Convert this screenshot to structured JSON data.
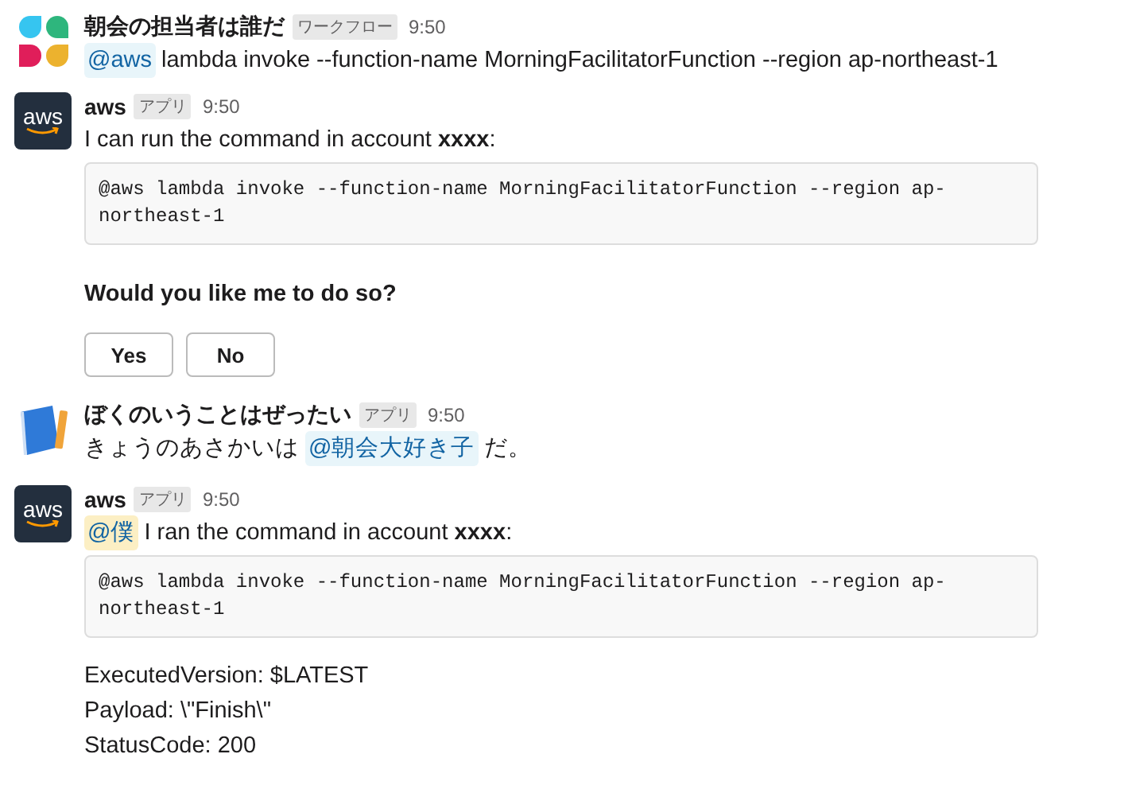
{
  "messages": [
    {
      "avatar": {
        "kind": "workflow"
      },
      "sender": "朝会の担当者は誰だ",
      "badge": "ワークフロー",
      "time": "9:50",
      "body": [
        {
          "kind": "text",
          "parts": [
            {
              "kind": "mention",
              "text": "@aws"
            },
            {
              "kind": "plain",
              "text": "lambda invoke --function-name MorningFacilitatorFunction --region ap-northeast-1"
            }
          ]
        }
      ]
    },
    {
      "avatar": {
        "kind": "aws",
        "text": "aws"
      },
      "sender": "aws",
      "badge": "アプリ",
      "time": "9:50",
      "body": [
        {
          "kind": "text",
          "parts": [
            {
              "kind": "plain",
              "text": "I can run the command in account **xxxx**:"
            }
          ]
        },
        {
          "kind": "code",
          "text": "@aws lambda invoke --function-name MorningFacilitatorFunction --region ap-northeast-1"
        },
        {
          "kind": "question",
          "text": "Would you like me to do so?"
        },
        {
          "kind": "buttons",
          "buttons": [
            "Yes",
            "No"
          ]
        }
      ]
    },
    {
      "avatar": {
        "kind": "notebook"
      },
      "sender": "ぼくのいうことはぜったい",
      "badge": "アプリ",
      "time": "9:50",
      "body": [
        {
          "kind": "text",
          "parts": [
            {
              "kind": "plain",
              "text": "きょうのあさかいは"
            },
            {
              "kind": "mention",
              "text": "@朝会大好き子"
            },
            {
              "kind": "plain",
              "text": "だ。"
            }
          ]
        }
      ]
    },
    {
      "avatar": {
        "kind": "aws",
        "text": "aws"
      },
      "sender": "aws",
      "badge": "アプリ",
      "time": "9:50",
      "body": [
        {
          "kind": "text",
          "parts": [
            {
              "kind": "self_mention",
              "text": "@僕"
            },
            {
              "kind": "plain",
              "text": "I ran the command in account **xxxx**:"
            }
          ]
        },
        {
          "kind": "code",
          "text": "@aws lambda invoke --function-name MorningFacilitatorFunction --region ap-northeast-1"
        },
        {
          "kind": "gap"
        },
        {
          "kind": "line",
          "text": "ExecutedVersion: $LATEST"
        },
        {
          "kind": "line",
          "text": "Payload: \\\"Finish\\\""
        },
        {
          "kind": "line",
          "text": "StatusCode: 200"
        }
      ]
    }
  ]
}
